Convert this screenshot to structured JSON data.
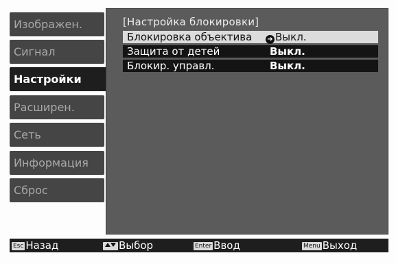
{
  "menu": {
    "items": [
      {
        "label": "Изображен.",
        "active": false
      },
      {
        "label": "Сигнал",
        "active": false
      },
      {
        "label": "Настройки",
        "active": true
      },
      {
        "label": "Расширен.",
        "active": false
      },
      {
        "label": "Сеть",
        "active": false
      },
      {
        "label": "Информация",
        "active": false
      },
      {
        "label": "Сброс",
        "active": false
      }
    ]
  },
  "panel": {
    "title": "[Настройка блокировки]",
    "rows": [
      {
        "label": "Блокировка объектива",
        "value": "Выкл.",
        "selected": true
      },
      {
        "label": "Защита от детей",
        "value": "Выкл.",
        "selected": false
      },
      {
        "label": "Блокир. управл.",
        "value": "Выкл.",
        "selected": false
      }
    ]
  },
  "footer": {
    "back_key": "Esc",
    "back_label": "Назад",
    "select_label": "Выбор",
    "enter_key": "Enter",
    "enter_label": "Ввод",
    "menu_key": "Menu",
    "exit_label": "Выход"
  },
  "icons": {
    "selected_pointer": "enter-pointer-icon",
    "nav_arrows": "up-down-arrows-icon"
  }
}
